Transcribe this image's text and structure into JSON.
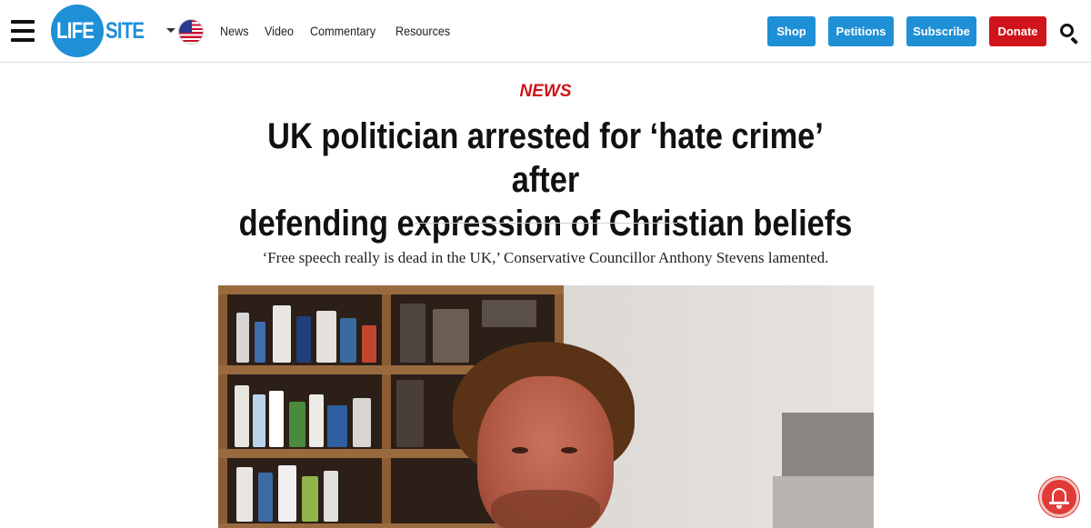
{
  "header": {
    "logo": {
      "left": "LIFE",
      "right": "SITE"
    },
    "nav": [
      "News",
      "Video",
      "Commentary",
      "Resources"
    ],
    "buttons": {
      "shop": "Shop",
      "petitions": "Petitions",
      "subscribe": "Subscribe",
      "donate": "Donate"
    },
    "icons": {
      "menu": "hamburger-icon",
      "region": "us-flag-icon",
      "search": "search-icon"
    }
  },
  "article": {
    "category": "NEWS",
    "headline_line1": "UK politician arrested for ‘hate crime’ after",
    "headline_line2": "defending expression of Christian beliefs",
    "dek": "‘Free speech really is dead in the UK,’ Conservative Councillor Anthony Stevens lamented."
  },
  "widgets": {
    "notification": "bell-icon"
  },
  "colors": {
    "brand_blue": "#1f8fd6",
    "donate_red": "#d0141b",
    "category_red": "#d0141b",
    "bell_red": "#e23a36"
  }
}
